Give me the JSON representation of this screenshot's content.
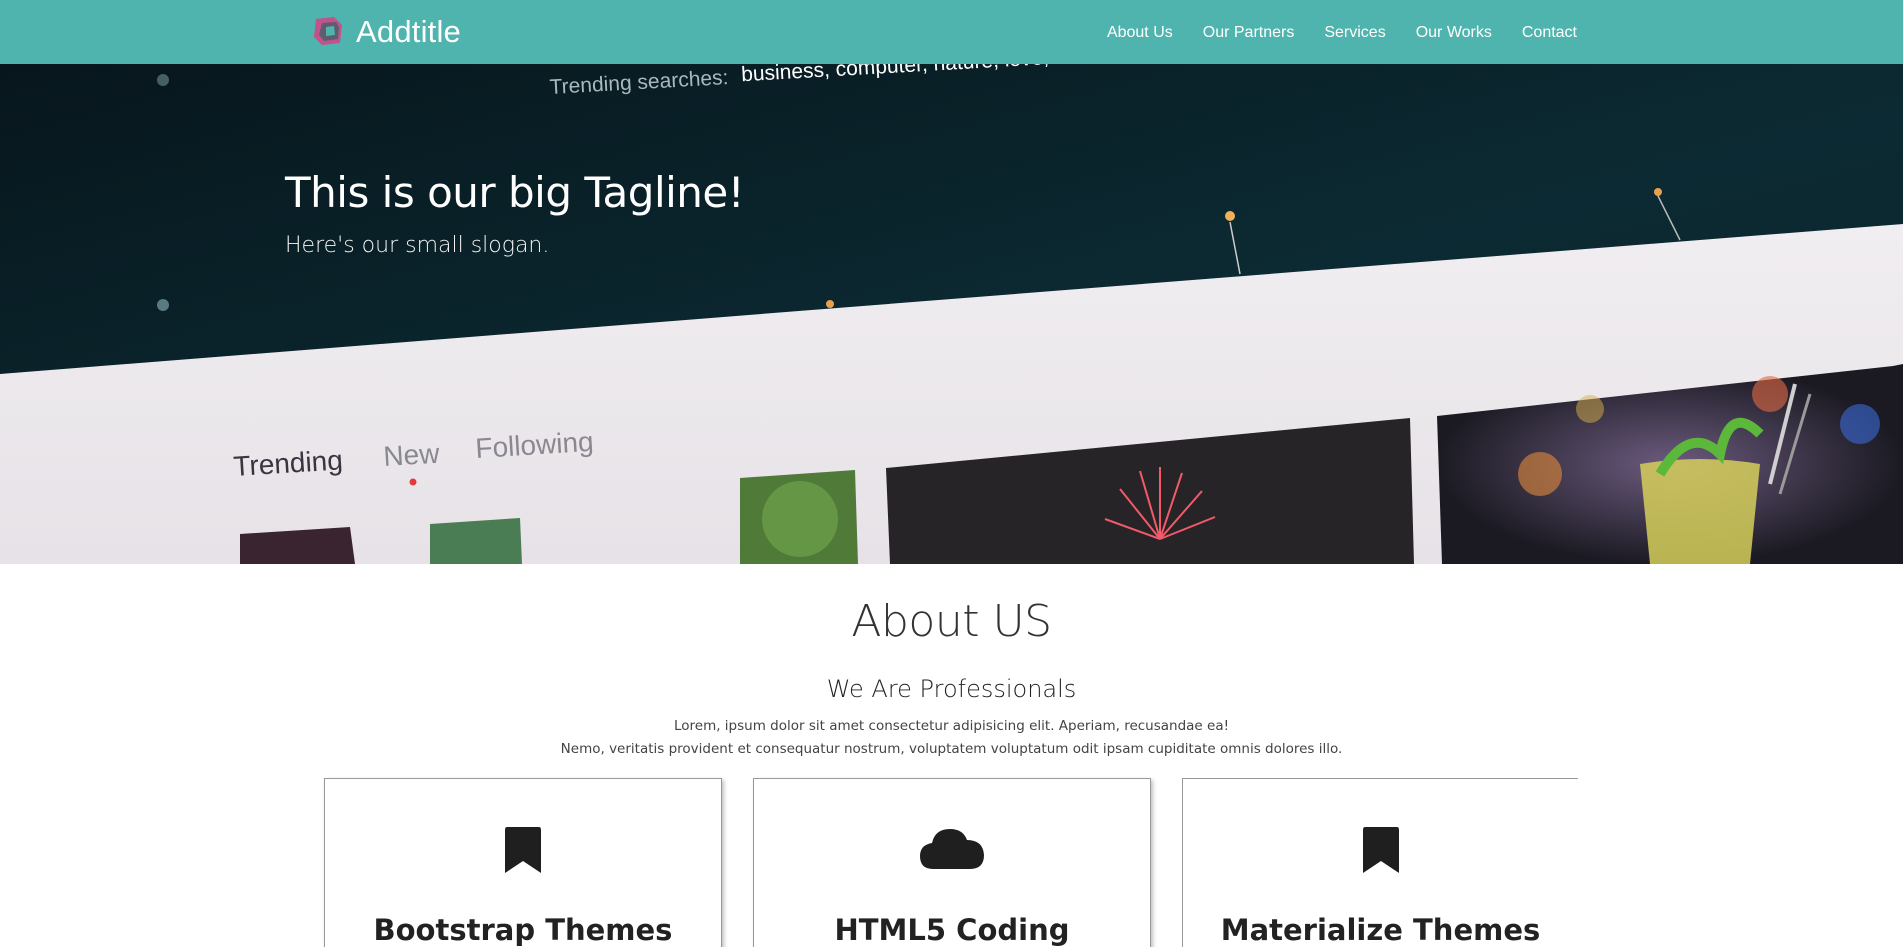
{
  "brand": {
    "name": "Addtitle"
  },
  "nav": {
    "items": [
      {
        "label": "About Us"
      },
      {
        "label": "Our Partners"
      },
      {
        "label": "Services"
      },
      {
        "label": "Our Works"
      },
      {
        "label": "Contact"
      }
    ]
  },
  "hero": {
    "title": "This is our big Tagline!",
    "slogan": "Here's our small slogan.",
    "photo": {
      "trending_label": "Trending searches:",
      "trending_terms": "business, computer, nature, love, house",
      "tabs": [
        "Trending",
        "New",
        "Following"
      ]
    }
  },
  "about": {
    "title": "About US",
    "subtitle": "We Are Professionals",
    "paragraph_line1": "Lorem, ipsum dolor sit amet consectetur adipisicing elit. Aperiam, recusandae ea!",
    "paragraph_line2": "Nemo, veritatis provident et consequatur nostrum, voluptatem voluptatum odit ipsam cupiditate omnis dolores illo."
  },
  "cards": [
    {
      "title": "Bootstrap Themes",
      "icon": "bookmark-icon"
    },
    {
      "title": "HTML5 Coding",
      "icon": "cloud-icon"
    },
    {
      "title": "Materialize Themes",
      "icon": "bookmark-icon"
    }
  ],
  "colors": {
    "navbar": "#4fb4ad",
    "hero_dark": "#0a1e26",
    "text_dark": "#222222"
  }
}
